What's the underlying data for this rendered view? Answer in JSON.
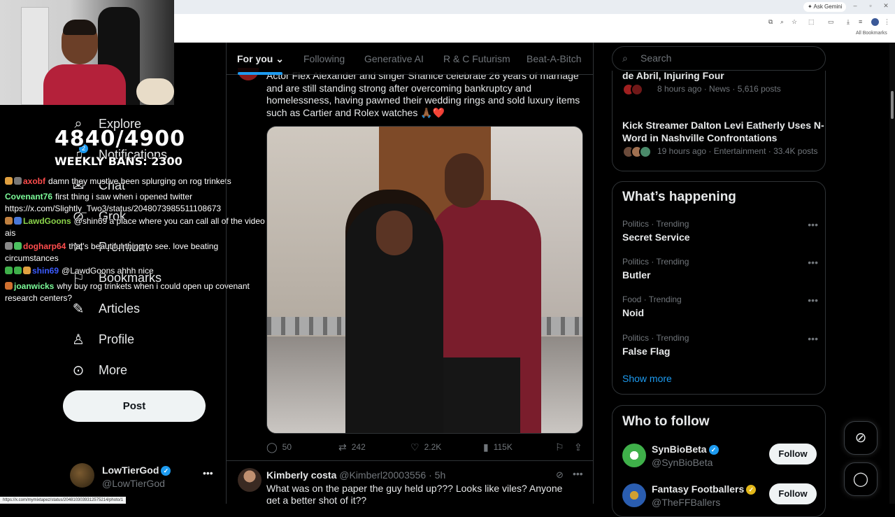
{
  "browser": {
    "ask_gemini": "✦ Ask Gemini",
    "all_bookmarks": "All Bookmarks",
    "status_url": "https://x.com/mymixtapez/status/2048103039312575214/photo/1"
  },
  "stream_overlay": {
    "ban_count": "4840/4900",
    "weekly_bans": "WEEKLY BANS: 2300",
    "chat": [
      {
        "user": "axobf",
        "user_color": "#ff4d4d",
        "message": "damn they must've been splurging on rog trinkets"
      },
      {
        "user": "Covenant76",
        "user_color": "#7cfc9a",
        "message": "first thing i saw when i opened twitter"
      },
      {
        "user": "",
        "user_color": "#ffffff",
        "message": "https://x.com/Slightly_Two3/status/2048073985511108673"
      },
      {
        "user": "LawdGoons",
        "user_color": "#8ad24a",
        "message": "@shin69 a place where you can call all of the video"
      },
      {
        "user": "",
        "user_color": "#ffffff",
        "message": "ais"
      },
      {
        "user": "dogharp64",
        "user_color": "#ff4d4d",
        "message": "that's beautiful thing to see. love beating"
      },
      {
        "user": "",
        "user_color": "#ffffff",
        "message": "circumstances"
      },
      {
        "user": "shin69",
        "user_color": "#3b5bff",
        "message": "@LawdGoons ahhh nice"
      },
      {
        "user": "joanwicks",
        "user_color": "#7cfc9a",
        "message": "why buy rog trinkets when i could open up covenant"
      },
      {
        "user": "",
        "user_color": "#ffffff",
        "message": "research centers?"
      }
    ]
  },
  "sidebar": {
    "items": [
      {
        "label": "Explore",
        "icon": "search-icon",
        "glyph": "⌕"
      },
      {
        "label": "Notifications",
        "icon": "bell-icon",
        "glyph": "🔔︎"
      },
      {
        "label": "Chat",
        "icon": "chat-icon",
        "glyph": "✉"
      },
      {
        "label": "Grok",
        "icon": "grok-icon",
        "glyph": "⊘"
      },
      {
        "label": "Premium",
        "icon": "x-logo-icon",
        "glyph": "✕"
      },
      {
        "label": "Bookmarks",
        "icon": "bookmark-icon",
        "glyph": "⚐"
      },
      {
        "label": "Articles",
        "icon": "article-icon",
        "glyph": "✎"
      },
      {
        "label": "Profile",
        "icon": "person-icon",
        "glyph": "♙"
      },
      {
        "label": "More",
        "icon": "more-circle-icon",
        "glyph": "⊙"
      }
    ],
    "notif_count": "2",
    "post_button": "Post",
    "account": {
      "name": "LowTierGod",
      "handle": "@LowTierGod"
    }
  },
  "feed": {
    "tabs": [
      "For you",
      "Following",
      "Generative AI",
      "R & C Futurism",
      "Beat-A-Bitch"
    ],
    "active_tab": "For you",
    "tweet1": {
      "text": "Actor Flex Alexander and singer Shanice celebrate 26 years of marriage and are still standing strong after overcoming bankruptcy and homelessness, having pawned their wedding rings and sold luxury items such as Cartier and Rolex watches 🙏🏾❤️",
      "replies": "50",
      "reposts": "242",
      "likes": "2.2K",
      "views": "115K"
    },
    "tweet2": {
      "name": "Kimberly costa",
      "handle": "@Kimberl20003556",
      "time": "· 5h",
      "text": "What was on the paper the guy held up??? Looks like viles? Anyone get a better shot of it??"
    }
  },
  "right": {
    "search_placeholder": "Search",
    "news": [
      {
        "title": "de Abril, Injuring Four",
        "meta": "8 hours ago · News · 5,616 posts"
      },
      {
        "title": "Kick Streamer Dalton Levi Eatherly Uses N-Word in Nashville Confrontations",
        "meta": "19 hours ago · Entertainment · 33.4K posts"
      }
    ],
    "whats_happening": "What’s happening",
    "trends": [
      {
        "category": "Politics · Trending",
        "name": "Secret Service"
      },
      {
        "category": "Politics · Trending",
        "name": "Butler"
      },
      {
        "category": "Food · Trending",
        "name": "Noid"
      },
      {
        "category": "Politics · Trending",
        "name": "False Flag"
      }
    ],
    "show_more": "Show more",
    "who_to_follow": "Who to follow",
    "follow": [
      {
        "name": "SynBioBeta",
        "handle": "@SynBioBeta",
        "button": "Follow",
        "color": "#3fb04a"
      },
      {
        "name": "Fantasy Footballers",
        "handle": "@TheFFBallers",
        "button": "Follow",
        "color": "#2a5db0"
      }
    ]
  },
  "colors": {
    "accent": "#1d9bf0",
    "background": "#000000",
    "muted": "#71767b"
  }
}
